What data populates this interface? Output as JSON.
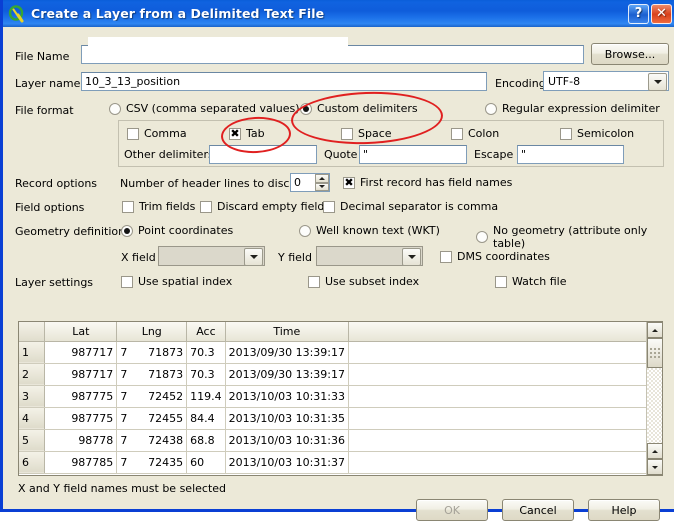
{
  "window": {
    "title": "Create a Layer from a Delimited Text File",
    "icon": "qgis-logo-icon",
    "help_button": "?",
    "close_button": "✕"
  },
  "form": {
    "file_name_label": "File Name",
    "file_name_value": "",
    "browse_label": "Browse...",
    "layer_name_label": "Layer name",
    "layer_name_value": "10_3_13_position",
    "encoding_label": "Encoding",
    "encoding_value": "UTF-8",
    "file_format_label": "File format",
    "format_options": [
      {
        "label": "CSV (comma separated values)",
        "selected": false
      },
      {
        "label": "Custom delimiters",
        "selected": true
      },
      {
        "label": "Regular expression delimiter",
        "selected": false
      }
    ],
    "delimiters": [
      {
        "label": "Comma",
        "checked": false
      },
      {
        "label": "Tab",
        "checked": true
      },
      {
        "label": "Space",
        "checked": false
      },
      {
        "label": "Colon",
        "checked": false
      },
      {
        "label": "Semicolon",
        "checked": false
      }
    ],
    "other_delimiters_label": "Other delimiters",
    "other_delimiters_value": "",
    "quote_label": "Quote",
    "quote_value": "\"",
    "escape_label": "Escape",
    "escape_value": "\"",
    "record_options_label": "Record options",
    "header_lines_label": "Number of header lines to discard",
    "header_lines_value": "0",
    "first_record_label": "First record has field names",
    "first_record_checked": true,
    "field_options_label": "Field options",
    "field_options": [
      {
        "label": "Trim fields",
        "checked": false
      },
      {
        "label": "Discard empty fields",
        "checked": false
      },
      {
        "label": "Decimal separator is comma",
        "checked": false
      }
    ],
    "geometry_label": "Geometry definition",
    "geometry_options": [
      {
        "label": "Point coordinates",
        "selected": true
      },
      {
        "label": "Well known text (WKT)",
        "selected": false
      },
      {
        "label": "No geometry (attribute only table)",
        "selected": false
      }
    ],
    "x_field_label": "X field",
    "x_field_value": "",
    "y_field_label": "Y field",
    "y_field_value": "",
    "dms_label": "DMS coordinates",
    "dms_checked": false,
    "layer_settings_label": "Layer settings",
    "layer_settings": [
      {
        "label": "Use spatial index",
        "checked": false
      },
      {
        "label": "Use subset index",
        "checked": false
      },
      {
        "label": "Watch file",
        "checked": false
      }
    ]
  },
  "preview_table": {
    "columns": [
      "Lat",
      "Lng",
      "Acc",
      "Time"
    ],
    "rows": [
      {
        "n": "1",
        "lat": "987717",
        "lng_prefix": "7",
        "lng": "71873",
        "acc": "70.3",
        "time": "2013/09/30 13:39:17"
      },
      {
        "n": "2",
        "lat": "987717",
        "lng_prefix": "7",
        "lng": "71873",
        "acc": "70.3",
        "time": "2013/09/30 13:39:17"
      },
      {
        "n": "3",
        "lat": "987775",
        "lng_prefix": "7",
        "lng": "72452",
        "acc": "119.4",
        "time": "2013/10/03 10:31:33"
      },
      {
        "n": "4",
        "lat": "987775",
        "lng_prefix": "7",
        "lng": "72455",
        "acc": "84.4",
        "time": "2013/10/03 10:31:35"
      },
      {
        "n": "5",
        "lat": "98778",
        "lng_prefix": "7",
        "lng": "72438",
        "acc": "68.8",
        "time": "2013/10/03 10:31:36"
      },
      {
        "n": "6",
        "lat": "987785",
        "lng_prefix": "7",
        "lng": "72435",
        "acc": "60",
        "time": "2013/10/03 10:31:37"
      }
    ]
  },
  "status_message": "X and Y field names must be selected",
  "buttons": {
    "ok": "OK",
    "ok_enabled": false,
    "cancel": "Cancel",
    "help": "Help"
  },
  "annotations": {
    "accent_color": "#e02020",
    "highlighted": [
      "Custom delimiters",
      "Tab"
    ]
  }
}
